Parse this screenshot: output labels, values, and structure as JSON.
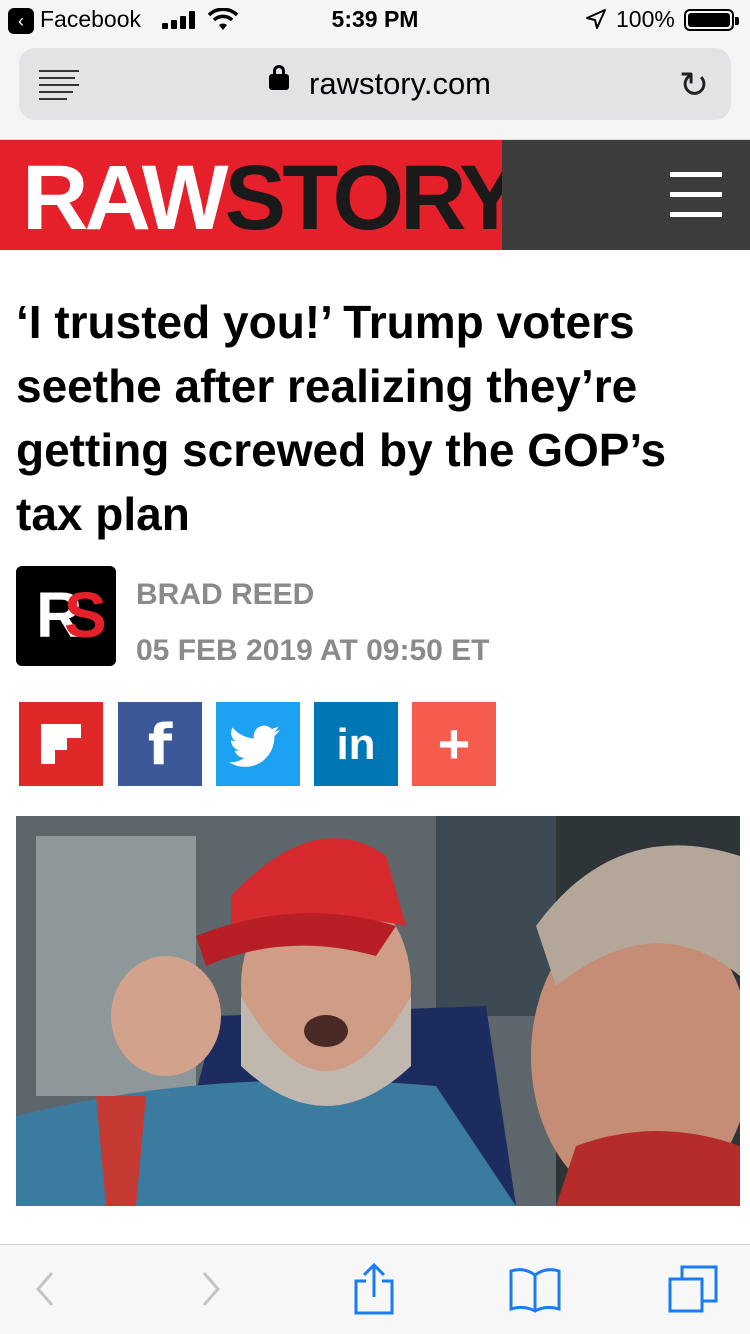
{
  "status_bar": {
    "back_app": "Facebook",
    "time": "5:39 PM",
    "battery": "100%"
  },
  "browser": {
    "domain": "rawstory.com"
  },
  "site": {
    "logo_raw": "RAW",
    "logo_story": "STORY",
    "brand_red": "#e5202a"
  },
  "article": {
    "headline": "‘I trusted you!’ Trump voters seethe after realizing they’re getting screwed by the GOP’s tax plan",
    "author": "BRAD REED",
    "date": "05 FEB 2019 AT 09:50 ET",
    "logo_r": "R",
    "logo_s": "S"
  },
  "share": {
    "facebook": "f",
    "linkedin": "in",
    "more": "+"
  },
  "icons": {
    "toolbar": [
      "back-icon",
      "forward-icon",
      "share-icon",
      "bookmarks-icon",
      "tabs-icon"
    ]
  }
}
